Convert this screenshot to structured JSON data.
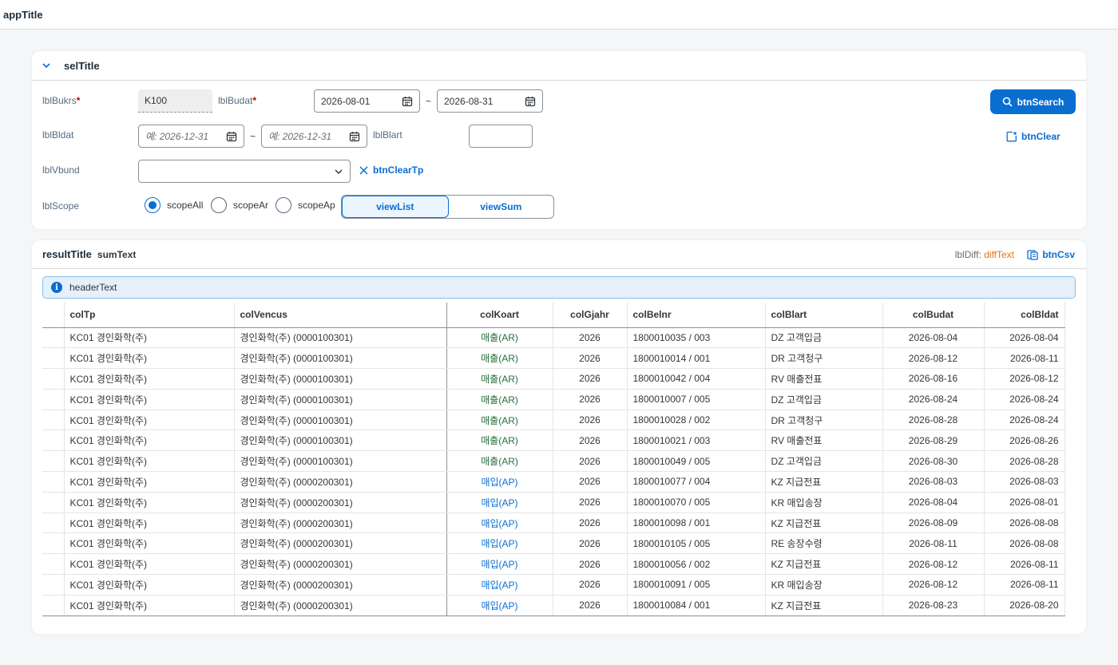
{
  "app": {
    "title": "appTitle"
  },
  "selection": {
    "title": "selTitle",
    "bukrs_label": "lblBukrs",
    "bukrs_value": "K100",
    "budat_label": "lblBudat",
    "budat_from": "2026-08-01",
    "budat_to": "2026-08-31",
    "bldat_label": "lblBldat",
    "bldat_from_placeholder": "예: 2026-12-31",
    "bldat_to_placeholder": "예: 2026-12-31",
    "blart_label": "lblBlart",
    "blart_value": "",
    "vbund_label": "lblVbund",
    "vbund_value": "",
    "scope_label": "lblScope",
    "scope_options": [
      "scopeAll",
      "scopeAr",
      "scopeAp"
    ],
    "scope_selected": "scopeAll",
    "view_options": [
      "viewList",
      "viewSum"
    ],
    "view_selected": "viewList",
    "tilde": "~",
    "search_label": "btnSearch",
    "clear_label": "btnClear",
    "clear_tp_label": "btnClearTp"
  },
  "result": {
    "title": "resultTitle",
    "sum_text": "sumText",
    "diff_label": "lblDiff:",
    "diff_value": "diffText",
    "csv_label": "btnCsv",
    "header_text": "headerText",
    "columns": [
      "colTp",
      "colVencus",
      "colKoart",
      "colGjahr",
      "colBelnr",
      "colBlart",
      "colBudat",
      "colBldat"
    ],
    "rows": [
      [
        "KC01 경인화학(주)",
        "경인화학(주) (0000100301)",
        "매출(AR)",
        "2026",
        "1800010035 / 003",
        "DZ 고객입금",
        "2026-08-04",
        "2026-08-04"
      ],
      [
        "KC01 경인화학(주)",
        "경인화학(주) (0000100301)",
        "매출(AR)",
        "2026",
        "1800010014 / 001",
        "DR 고객청구",
        "2026-08-12",
        "2026-08-11"
      ],
      [
        "KC01 경인화학(주)",
        "경인화학(주) (0000100301)",
        "매출(AR)",
        "2026",
        "1800010042 / 004",
        "RV 매출전표",
        "2026-08-16",
        "2026-08-12"
      ],
      [
        "KC01 경인화학(주)",
        "경인화학(주) (0000100301)",
        "매출(AR)",
        "2026",
        "1800010007 / 005",
        "DZ 고객입금",
        "2026-08-24",
        "2026-08-24"
      ],
      [
        "KC01 경인화학(주)",
        "경인화학(주) (0000100301)",
        "매출(AR)",
        "2026",
        "1800010028 / 002",
        "DR 고객청구",
        "2026-08-28",
        "2026-08-24"
      ],
      [
        "KC01 경인화학(주)",
        "경인화학(주) (0000100301)",
        "매출(AR)",
        "2026",
        "1800010021 / 003",
        "RV 매출전표",
        "2026-08-29",
        "2026-08-26"
      ],
      [
        "KC01 경인화학(주)",
        "경인화학(주) (0000100301)",
        "매출(AR)",
        "2026",
        "1800010049 / 005",
        "DZ 고객입금",
        "2026-08-30",
        "2026-08-28"
      ],
      [
        "KC01 경인화학(주)",
        "경인화학(주) (0000200301)",
        "매입(AP)",
        "2026",
        "1800010077 / 004",
        "KZ 지급전표",
        "2026-08-03",
        "2026-08-03"
      ],
      [
        "KC01 경인화학(주)",
        "경인화학(주) (0000200301)",
        "매입(AP)",
        "2026",
        "1800010070 / 005",
        "KR 매입송장",
        "2026-08-04",
        "2026-08-01"
      ],
      [
        "KC01 경인화학(주)",
        "경인화학(주) (0000200301)",
        "매입(AP)",
        "2026",
        "1800010098 / 001",
        "KZ 지급전표",
        "2026-08-09",
        "2026-08-08"
      ],
      [
        "KC01 경인화학(주)",
        "경인화학(주) (0000200301)",
        "매입(AP)",
        "2026",
        "1800010105 / 005",
        "RE 송장수령",
        "2026-08-11",
        "2026-08-08"
      ],
      [
        "KC01 경인화학(주)",
        "경인화학(주) (0000200301)",
        "매입(AP)",
        "2026",
        "1800010056 / 002",
        "KZ 지급전표",
        "2026-08-12",
        "2026-08-11"
      ],
      [
        "KC01 경인화학(주)",
        "경인화학(주) (0000200301)",
        "매입(AP)",
        "2026",
        "1800010091 / 005",
        "KR 매입송장",
        "2026-08-12",
        "2026-08-11"
      ],
      [
        "KC01 경인화학(주)",
        "경인화학(주) (0000200301)",
        "매입(AP)",
        "2026",
        "1800010084 / 001",
        "KZ 지급전표",
        "2026-08-23",
        "2026-08-20"
      ]
    ]
  },
  "icons": {
    "collapse": "chevron-down-icon",
    "calendar": "calendar-icon",
    "dropdown": "chevron-down-icon",
    "search": "search-icon",
    "clear": "clear-filter-icon",
    "close": "close-icon",
    "info": "information-icon",
    "csv": "excel-export-icon"
  },
  "colors": {
    "accent": "#0a6ed1",
    "ar": "#256f3a",
    "diff": "#e9730c",
    "required": "#bb0000"
  }
}
